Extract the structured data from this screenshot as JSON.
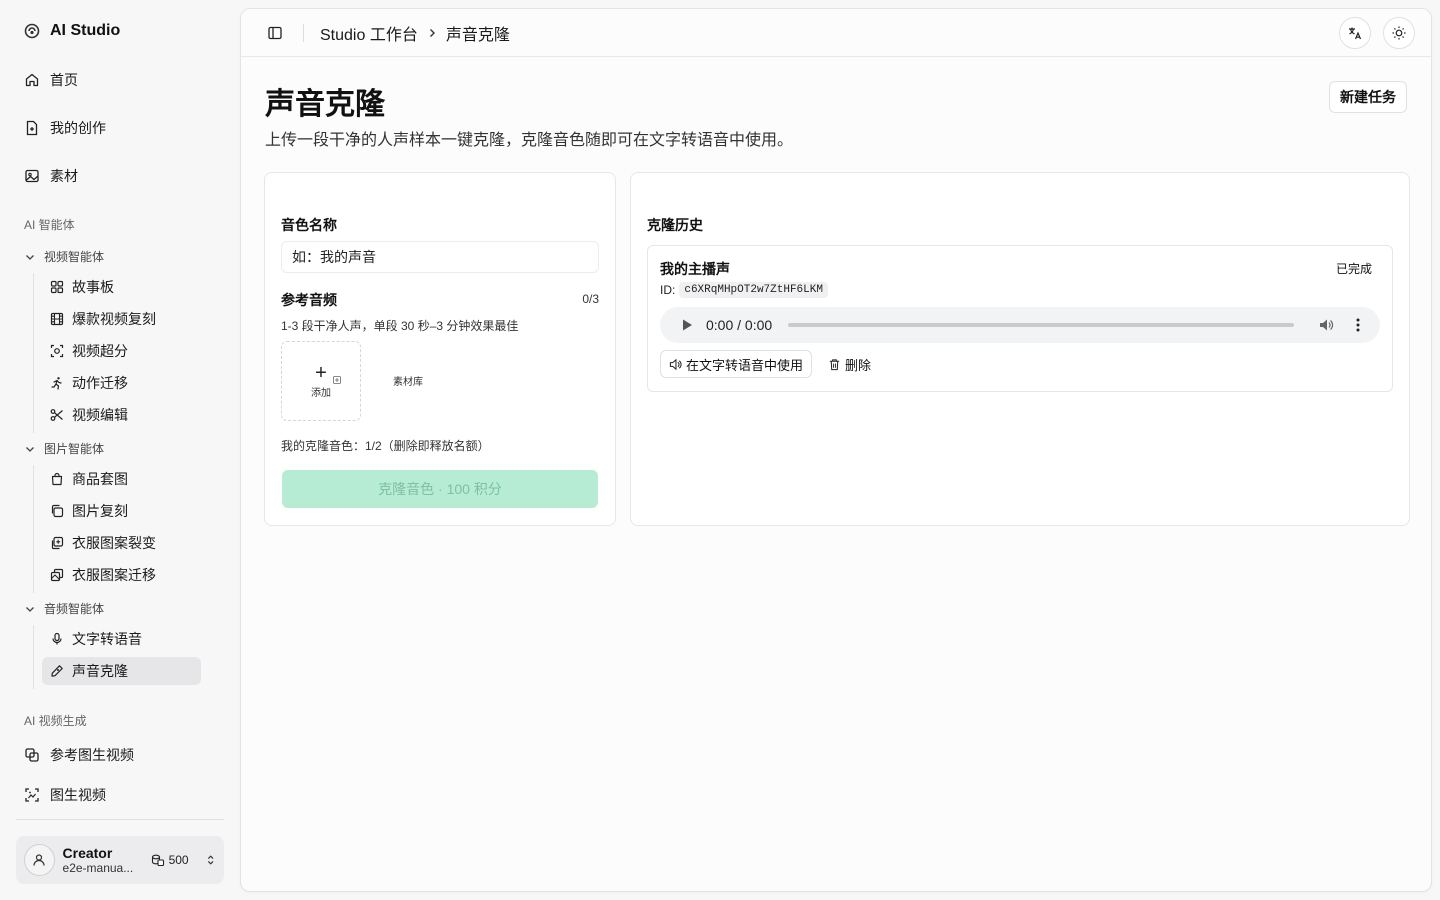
{
  "app": {
    "name": "AI Studio"
  },
  "sidebar": {
    "top_items": [
      {
        "label": "首页",
        "icon": "home-icon"
      },
      {
        "label": "我的创作",
        "icon": "file-icon"
      },
      {
        "label": "素材",
        "icon": "image-icon"
      }
    ],
    "section_ai_agents": "AI 智能体",
    "groups": [
      {
        "label": "视频智能体",
        "items": [
          {
            "label": "故事板",
            "icon": "grid-icon"
          },
          {
            "label": "爆款视频复刻",
            "icon": "film-icon"
          },
          {
            "label": "视频超分",
            "icon": "scan-icon"
          },
          {
            "label": "动作迁移",
            "icon": "running-icon"
          },
          {
            "label": "视频编辑",
            "icon": "scissors-icon"
          }
        ]
      },
      {
        "label": "图片智能体",
        "items": [
          {
            "label": "商品套图",
            "icon": "shopping-bag-icon"
          },
          {
            "label": "图片复刻",
            "icon": "copy-icon"
          },
          {
            "label": "衣服图案裂变",
            "icon": "image-plus-icon"
          },
          {
            "label": "衣服图案迁移",
            "icon": "transfer-icon"
          }
        ]
      },
      {
        "label": "音频智能体",
        "items": [
          {
            "label": "文字转语音",
            "icon": "microphone-icon"
          },
          {
            "label": "声音克隆",
            "icon": "pen-icon",
            "active": true
          }
        ]
      }
    ],
    "section_ai_video": "AI 视频生成",
    "video_items": [
      {
        "label": "参考图生视频",
        "icon": "layers-icon"
      },
      {
        "label": "图生视频",
        "icon": "scan-image-icon"
      }
    ],
    "user": {
      "name": "Creator",
      "email": "e2e-manua...",
      "credits": "500"
    }
  },
  "topbar": {
    "breadcrumb_root": "Studio 工作台",
    "breadcrumb_current": "声音克隆"
  },
  "page": {
    "title": "声音克隆",
    "description": "上传一段干净的人声样本一键克隆，克隆音色随即可在文字转语音中使用。",
    "new_task_label": "新建任务"
  },
  "form": {
    "voice_name_label": "音色名称",
    "voice_name_placeholder": "如：我的声音",
    "ref_audio_label": "参考音频",
    "ref_audio_count": "0/3",
    "ref_audio_hint": "1-3 段干净人声，单段 30 秒–3 分钟效果最佳",
    "add_label": "添加",
    "library_label": "素材库",
    "quota_text": "我的克隆音色：1/2（删除即释放名额）",
    "clone_button_label": "克隆音色 · 100 积分"
  },
  "history": {
    "title": "克隆历史",
    "items": [
      {
        "name": "我的主播声",
        "status": "已完成",
        "id_label": "ID:",
        "id": "c6XRqMHpOT2w7ZtHF6LKM",
        "time": "0:00 / 0:00",
        "use_label": "在文字转语音中使用",
        "delete_label": "删除"
      }
    ]
  },
  "colors": {
    "accent_disabled_bg": "#b5ecd3",
    "accent_disabled_text": "#7fbfa2",
    "active_nav_bg": "#e6e6e8"
  }
}
